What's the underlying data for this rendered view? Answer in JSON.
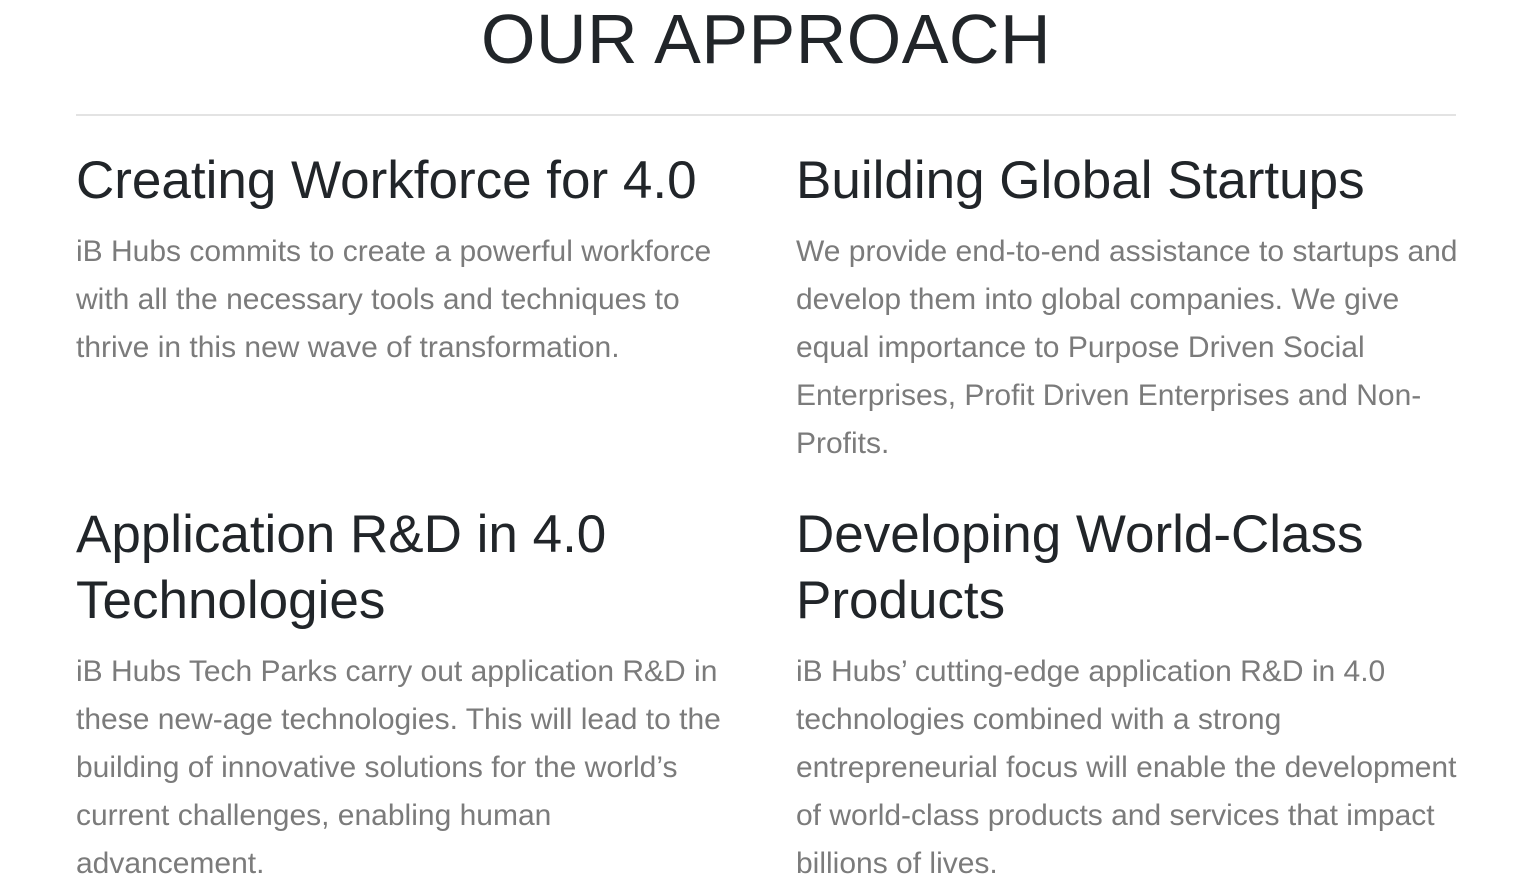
{
  "section": {
    "title": "OUR APPROACH"
  },
  "cards": [
    {
      "heading": "Creating Workforce for 4.0",
      "text": "iB Hubs commits to create a powerful workforce with all the necessary tools and techniques to thrive in this new wave of transformation."
    },
    {
      "heading": "Building Global Startups",
      "text": "We provide end-to-end assistance to startups and develop them into global companies. We give equal importance to Purpose Driven Social Enterprises, Profit Driven Enterprises and Non-Profits."
    },
    {
      "heading": "Application R&D in 4.0 Technologies",
      "text": "iB Hubs Tech Parks carry out application R&D in these new-age technologies. This will lead to the building of innovative solutions for the world’s current challenges, enabling human advancement."
    },
    {
      "heading": "Developing World-Class Products",
      "text": "iB Hubs’ cutting-edge application R&D in 4.0 technologies combined with a strong entrepreneurial focus will enable the development of world-class products and services that impact billions of lives."
    }
  ]
}
